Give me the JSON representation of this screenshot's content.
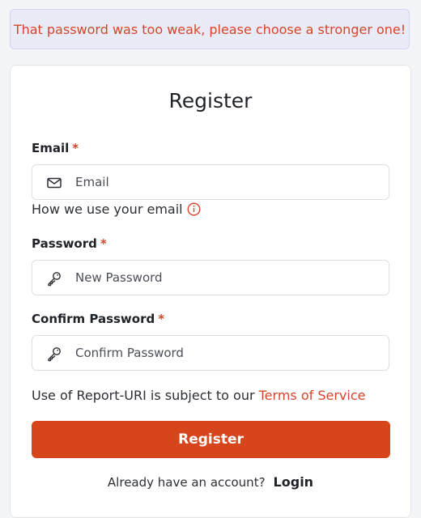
{
  "alert": {
    "message": "That password was too weak, please choose a stronger one!"
  },
  "form": {
    "title": "Register",
    "required_marker": "*",
    "email": {
      "label": "Email",
      "placeholder": "Email",
      "value": "",
      "icon": "envelope-icon"
    },
    "email_helper": {
      "text": "How we use your email",
      "icon": "info-icon"
    },
    "password": {
      "label": "Password",
      "placeholder": "New Password",
      "value": "",
      "icon": "key-icon"
    },
    "confirm_password": {
      "label": "Confirm Password",
      "placeholder": "Confirm Password",
      "value": "",
      "icon": "key-icon"
    },
    "terms": {
      "prefix": "Use of Report-URI is subject to our",
      "link_label": "Terms of Service"
    },
    "submit_label": "Register",
    "footer": {
      "prompt": "Already have an account?",
      "login_label": "Login"
    }
  },
  "colors": {
    "accent": "#d6451c",
    "alert_text": "#d6452b",
    "alert_bg": "#e9ebf6",
    "page_bg": "#f3f4f7"
  }
}
